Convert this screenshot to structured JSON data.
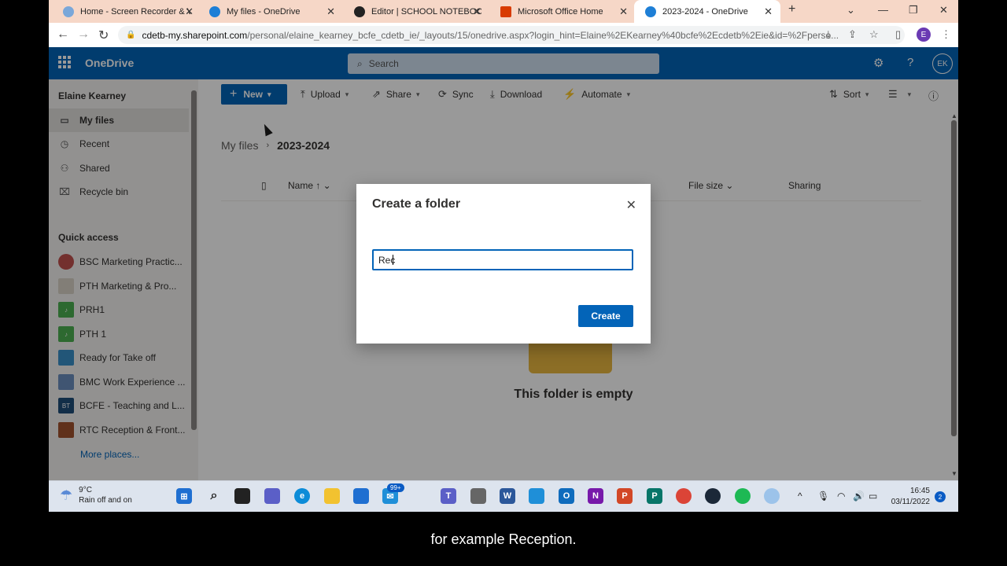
{
  "browser": {
    "tabs": [
      {
        "title": "Home - Screen Recorder & V",
        "color": "#7aa7d9"
      },
      {
        "title": "My files - OneDrive",
        "color": "#1e7fd6"
      },
      {
        "title": "Editor | SCHOOL NOTEBOOK",
        "color": "#222222"
      },
      {
        "title": "Microsoft Office Home",
        "color": "#d83b01"
      },
      {
        "title": "2023-2024 - OneDrive",
        "color": "#1e7fd6"
      }
    ],
    "new_tab": "+",
    "url_host": "cdetb-my.sharepoint.com",
    "url_rest": "/personal/elaine_kearney_bcfe_cdetb_ie/_layouts/15/onedrive.aspx?login_hint=Elaine%2EKearney%40bcfe%2Ecdetb%2Eie&id=%2Fperso...",
    "profile_initial": "E"
  },
  "header": {
    "app_name": "OneDrive",
    "search_placeholder": "Search",
    "user_initials": "EK"
  },
  "sidebar": {
    "user_name": "Elaine Kearney",
    "items": [
      {
        "label": "My files",
        "icon": "folder-icon",
        "glyph": "▭"
      },
      {
        "label": "Recent",
        "icon": "clock-icon",
        "glyph": "◷"
      },
      {
        "label": "Shared",
        "icon": "people-icon",
        "glyph": "⚇"
      },
      {
        "label": "Recycle bin",
        "icon": "trash-icon",
        "glyph": "🗑"
      }
    ],
    "quick_access_title": "Quick access",
    "quick_access": [
      {
        "label": "BSC Marketing Practic...",
        "color": "#c0504d"
      },
      {
        "label": "PTH Marketing & Pro...",
        "color": "#a5a5a5"
      },
      {
        "label": "PRH1",
        "color": "#4caf50"
      },
      {
        "label": "PTH 1",
        "color": "#4caf50"
      },
      {
        "label": "Ready for Take off",
        "color": "#3a8fc8"
      },
      {
        "label": "BMC Work Experience ...",
        "color": "#6c8ebf"
      },
      {
        "label": "BCFE - Teaching and L...",
        "color": "#1f4e79",
        "thumb_text": "BT"
      },
      {
        "label": "RTC Reception & Front...",
        "color": "#a0522d"
      }
    ],
    "more_places": "More places..."
  },
  "commandbar": {
    "new": "New",
    "upload": "Upload",
    "share": "Share",
    "sync": "Sync",
    "download": "Download",
    "automate": "Automate",
    "sort": "Sort"
  },
  "breadcrumb": {
    "root": "My files",
    "current": "2023-2024"
  },
  "columns": {
    "name": "Name ↑",
    "file_size": "File size",
    "sharing": "Sharing"
  },
  "empty_state": "This folder is empty",
  "dialog": {
    "title": "Create a folder",
    "input_value": "Rec",
    "create_label": "Create"
  },
  "taskbar": {
    "temperature": "9°C",
    "weather_text": "Rain off and on",
    "mail_badge": "99+",
    "time": "16:45",
    "date": "03/11/2022",
    "notifications": "2"
  },
  "caption": "for example Reception."
}
